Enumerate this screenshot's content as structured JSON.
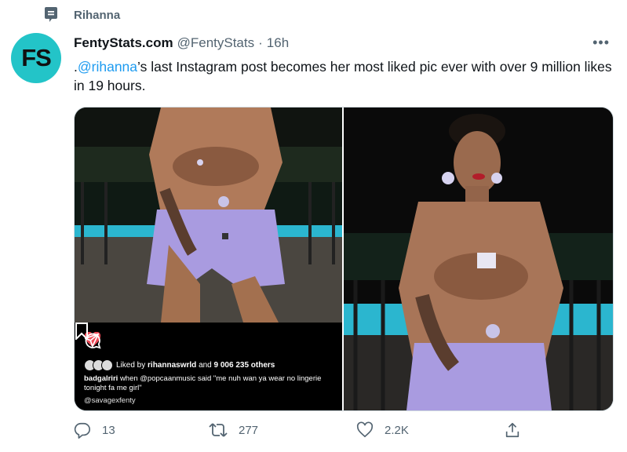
{
  "context": {
    "text": "Rihanna"
  },
  "author": {
    "avatar_text": "FS",
    "name": "FentyStats.com",
    "handle": "@FentyStats",
    "time": "16h"
  },
  "tweet": {
    "prefix": ".",
    "mention": "@rihanna",
    "rest": "’s last Instagram post becomes her most liked pic ever with over 9 million likes in 19 hours."
  },
  "instagram": {
    "liked_by_prefix": "Liked by",
    "liked_by_user": "rihannaswrld",
    "liked_by_and": "and",
    "like_count": "9 006 235 others",
    "caption_user": "badgalriri",
    "caption_text": "when @popcaanmusic said \"me nuh wan ya wear no lingerie tonight fa me girl\"",
    "tag": "@savagexfenty"
  },
  "actions": {
    "replies": "13",
    "retweets": "277",
    "likes": "2.2K"
  },
  "colors": {
    "accent": "#1d9bf0",
    "avatar_bg": "#23c4c8",
    "ig_heart": "#ed4956",
    "satin": "#a99be0"
  }
}
